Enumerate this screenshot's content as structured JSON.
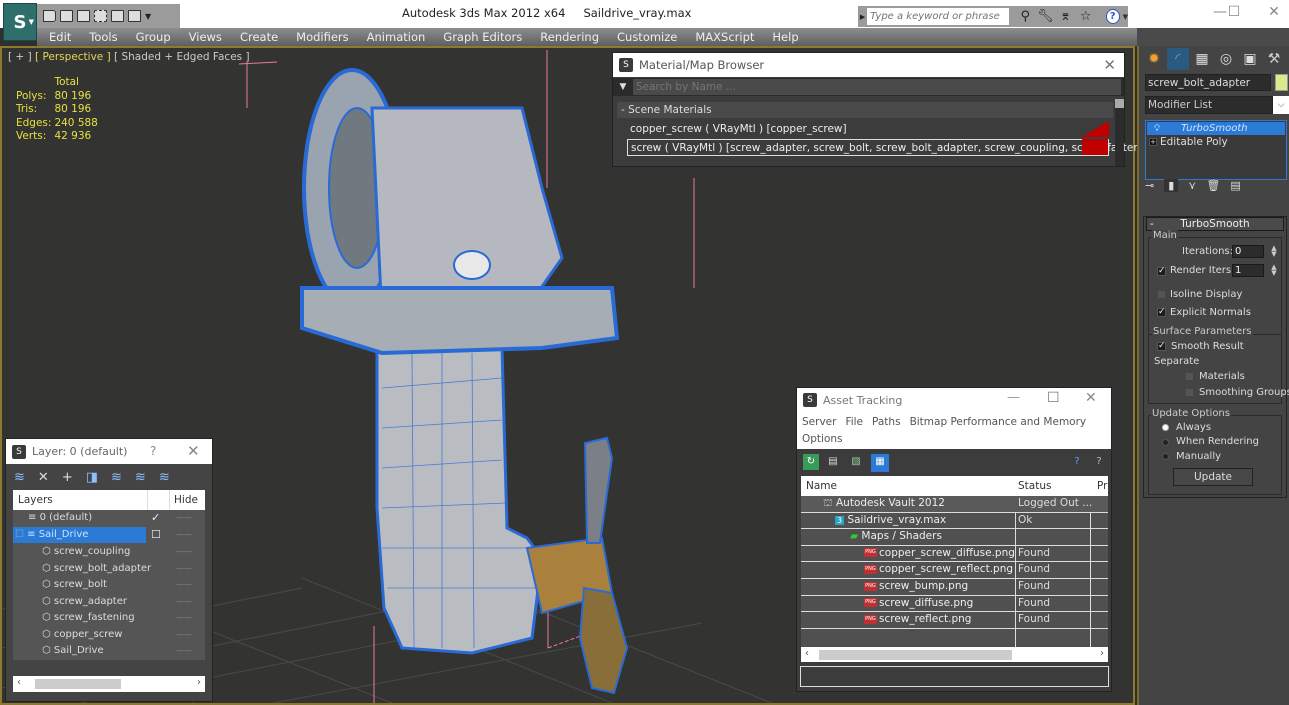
{
  "app": {
    "title": "Autodesk 3ds Max  2012 x64",
    "file": "Saildrive_vray.max",
    "search_placeholder": "Type a keyword or phrase"
  },
  "quick_access": [
    "new-icon",
    "open-icon",
    "save-icon",
    "undo-icon",
    "redo-icon",
    "project-icon",
    "more-icon"
  ],
  "menu": [
    "Edit",
    "Tools",
    "Group",
    "Views",
    "Create",
    "Modifiers",
    "Animation",
    "Graph Editors",
    "Rendering",
    "Customize",
    "MAXScript",
    "Help"
  ],
  "window_controls": {
    "minimize": "—",
    "maximize": "☐",
    "close": "✕"
  },
  "viewport": {
    "label_plus": "[ + ]",
    "label_view": "[ Perspective ]",
    "label_shading": "[ Shaded + Edged Faces ]",
    "stats": {
      "header": "Total",
      "rows": [
        {
          "label": "Polys:",
          "value": "80 196"
        },
        {
          "label": "Tris:",
          "value": "80 196"
        },
        {
          "label": "Edges:",
          "value": "240 588"
        },
        {
          "label": "Verts:",
          "value": "42 936"
        }
      ]
    }
  },
  "material_browser": {
    "title": "Material/Map Browser",
    "search_placeholder": "Search by Name ...",
    "group": "- Scene Materials",
    "materials": [
      {
        "label": "copper_screw  ( VRayMtl )  [copper_screw]",
        "color": "#c00000"
      },
      {
        "label": "screw  ( VRayMtl )  [screw_adapter, screw_bolt, screw_bolt_adapter, screw_coupling, screw_fastening]",
        "color": "#c00000"
      }
    ]
  },
  "command_panel": {
    "tabs": [
      "create-icon",
      "modify-icon",
      "hierarchy-icon",
      "motion-icon",
      "display-icon",
      "utilities-icon"
    ],
    "object_name": "screw_bolt_adapter",
    "object_color": "#dbe88c",
    "modifier_list": "Modifier List",
    "stack": [
      {
        "label": "TurboSmooth",
        "selected": true
      },
      {
        "label": "Editable Poly",
        "selected": false
      }
    ],
    "turbosmooth": {
      "title": "TurboSmooth",
      "main_label": "Main",
      "iterations_label": "Iterations:",
      "iterations": "0",
      "render_iters_label": "Render Iters:",
      "render_iters": "1",
      "render_iters_checked": true,
      "isoline_label": "Isoline Display",
      "isoline_checked": false,
      "explicit_label": "Explicit Normals",
      "explicit_checked": true,
      "surface_label": "Surface Parameters",
      "smooth_result_label": "Smooth Result",
      "smooth_result_checked": true,
      "separate_label": "Separate",
      "materials_label": "Materials",
      "smoothing_groups_label": "Smoothing Groups",
      "update_options_label": "Update Options",
      "always_label": "Always",
      "when_rendering_label": "When Rendering",
      "manually_label": "Manually",
      "update_button": "Update"
    }
  },
  "layer_dialog": {
    "title": "Layer: 0 (default)",
    "help": "?",
    "close": "✕",
    "col_layers": "Layers",
    "col_hide": "Hide",
    "rows": [
      {
        "name": "0 (default)",
        "type": "layer",
        "current": true
      },
      {
        "name": "Sail_Drive",
        "type": "layer",
        "selected": true
      },
      {
        "name": "screw_coupling",
        "type": "object"
      },
      {
        "name": "screw_bolt_adapter",
        "type": "object"
      },
      {
        "name": "screw_bolt",
        "type": "object"
      },
      {
        "name": "screw_adapter",
        "type": "object"
      },
      {
        "name": "screw_fastening",
        "type": "object"
      },
      {
        "name": "copper_screw",
        "type": "object"
      },
      {
        "name": "Sail_Drive",
        "type": "object"
      }
    ]
  },
  "asset_tracking": {
    "title": "Asset Tracking",
    "menu": [
      "Server",
      "File",
      "Paths",
      "Bitmap Performance and Memory",
      "Options"
    ],
    "col_name": "Name",
    "col_status": "Status",
    "col_pr": "Pr",
    "rows": [
      {
        "name": "Autodesk Vault 2012",
        "status": "Logged Out ...",
        "indent": 1,
        "icon": "vault-icon"
      },
      {
        "name": "Saildrive_vray.max",
        "status": "Ok",
        "indent": 2,
        "icon": "max-file-icon"
      },
      {
        "name": "Maps / Shaders",
        "status": "",
        "indent": 3,
        "icon": "maps-icon"
      },
      {
        "name": "copper_screw_diffuse.png",
        "status": "Found",
        "indent": 4,
        "icon": "png-icon"
      },
      {
        "name": "copper_screw_reflect.png",
        "status": "Found",
        "indent": 4,
        "icon": "png-icon"
      },
      {
        "name": "screw_bump.png",
        "status": "Found",
        "indent": 4,
        "icon": "png-icon"
      },
      {
        "name": "screw_diffuse.png",
        "status": "Found",
        "indent": 4,
        "icon": "png-icon"
      },
      {
        "name": "screw_reflect.png",
        "status": "Found",
        "indent": 4,
        "icon": "png-icon"
      }
    ]
  }
}
